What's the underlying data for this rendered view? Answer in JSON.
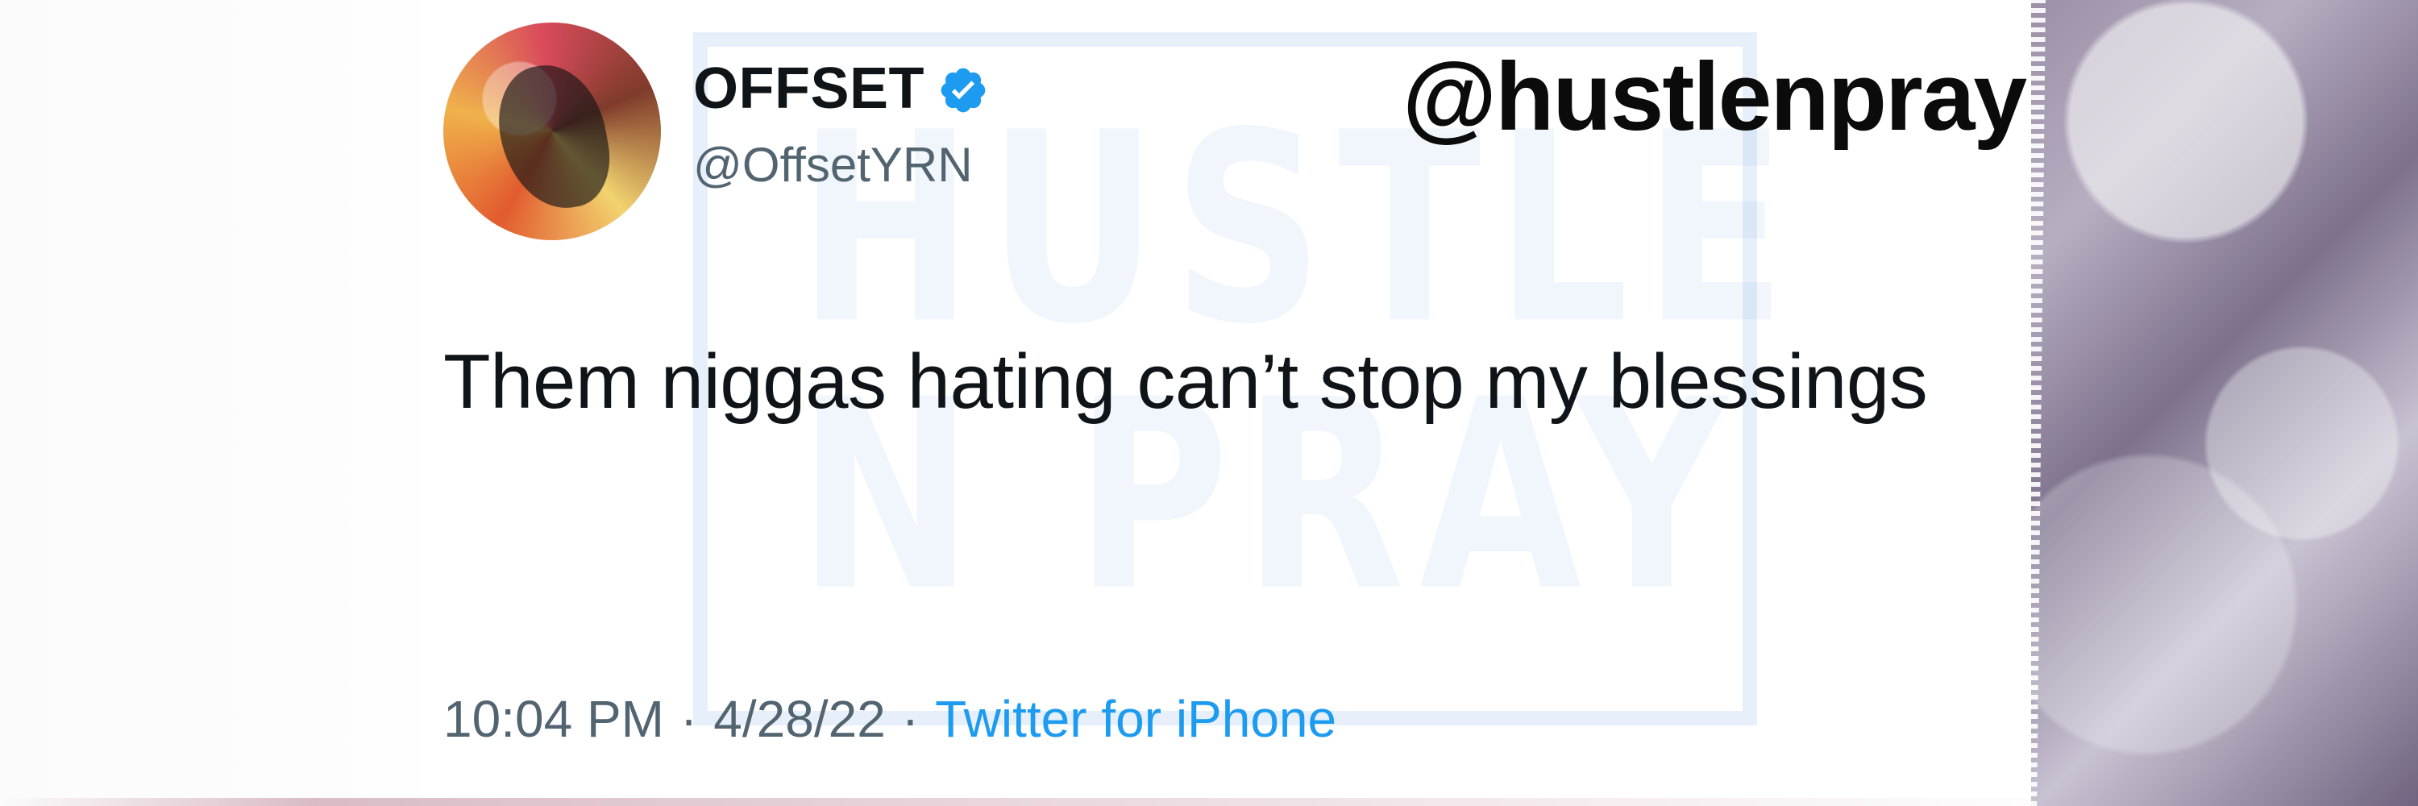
{
  "tweet": {
    "display_name": "OFFSET",
    "handle": "@OffsetYRN",
    "text": "Them niggas hating can’t stop my blessings",
    "time": "10:04 PM",
    "separator": "·",
    "date": "4/28/22",
    "source": "Twitter for iPhone"
  },
  "overlay": {
    "handle": "@hustlenpray"
  },
  "icons": {
    "verified": "verified-badge-icon"
  },
  "colors": {
    "twitter_blue": "#1D9BF0",
    "text_primary": "#0F1419",
    "text_secondary": "#536471"
  }
}
